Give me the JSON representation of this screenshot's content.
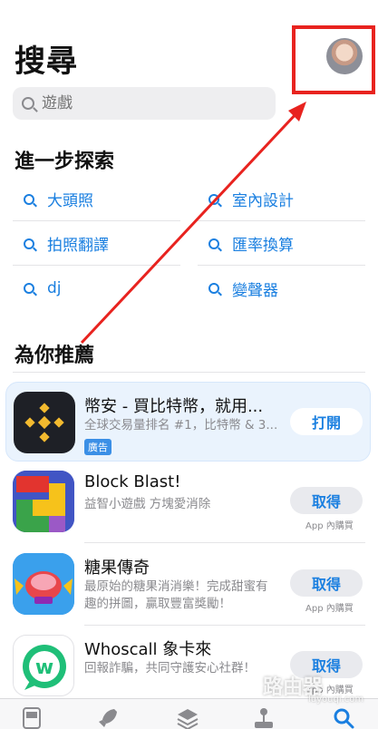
{
  "header": {
    "title": "搜尋"
  },
  "search": {
    "placeholder": "遊戲",
    "value": ""
  },
  "discover": {
    "title": "進一步探索",
    "items": [
      {
        "label": "大頭照"
      },
      {
        "label": "室內設計"
      },
      {
        "label": "拍照翻譯"
      },
      {
        "label": "匯率換算"
      },
      {
        "label": "dj"
      },
      {
        "label": "變聲器"
      }
    ]
  },
  "recommend": {
    "title": "為你推薦",
    "apps": [
      {
        "name": "幣安 - 買比特幣，就用...",
        "subtitle": "全球交易量排名 #1，比特幣 & 3...",
        "button": "打開",
        "badge": "廣告",
        "icon": "binance-icon"
      },
      {
        "name": "Block Blast!",
        "subtitle": "益智小遊戲 方塊愛消除",
        "button": "取得",
        "iap": "App 內購買",
        "icon": "block-blast-icon"
      },
      {
        "name": "糖果傳奇",
        "subtitle": "最原始的糖果消消樂！完成甜蜜有趣的拼圖，贏取豐富獎勵！",
        "button": "取得",
        "iap": "App 內購買",
        "icon": "candy-crush-icon"
      },
      {
        "name": "Whoscall 象卡來",
        "subtitle": "回報詐騙，共同守護安心社群！",
        "button": "取得",
        "iap": "App 內購買",
        "icon": "whoscall-icon"
      }
    ]
  },
  "tabbar": {
    "tabs": [
      {
        "icon": "today-icon"
      },
      {
        "icon": "games-rocket-icon"
      },
      {
        "icon": "apps-stack-icon"
      },
      {
        "icon": "arcade-joystick-icon"
      },
      {
        "icon": "search-icon"
      }
    ]
  },
  "watermark": {
    "text": "路由器",
    "sub": "luyouqi.com"
  },
  "colors": {
    "accent": "#1a7fe0",
    "annotation": "#e8231f"
  }
}
